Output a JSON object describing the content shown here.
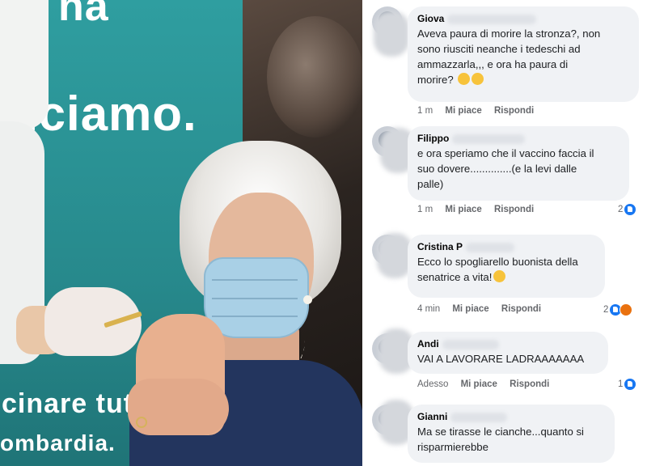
{
  "photo": {
    "poster_text_top": "na",
    "poster_text_middle": "nciamo.",
    "poster_text_bottom_1": "cinare tutta",
    "poster_text_bottom_2": "ombardia."
  },
  "comments": [
    {
      "author": "Giova",
      "text": "Aveva paura di morire la stronza?, non\nsono riusciti neanche i tedeschi ad\nammazzarla,,, e ora ha paura di\nmorire?",
      "emoji": "laughing-emoji x2",
      "time": "1 m",
      "like_label": "Mi piace",
      "reply_label": "Rispondi",
      "reaction_count": ""
    },
    {
      "author": "Filippo",
      "text": "e ora speriamo che il vaccino faccia il\nsuo dovere..............(e la levi dalle\npalle)",
      "time": "1 m",
      "like_label": "Mi piace",
      "reply_label": "Rispondi",
      "reaction_count": "2"
    },
    {
      "author": "Cristina P",
      "text": "Ecco lo spogliarello buonista della\nsenatrice a vita!",
      "emoji": "smirk-emoji",
      "time": "4 min",
      "like_label": "Mi piace",
      "reply_label": "Rispondi",
      "reaction_count": "2"
    },
    {
      "author": "Andi",
      "text": "VAI A LAVORARE LADRAAAAAAA",
      "time": "Adesso",
      "like_label": "Mi piace",
      "reply_label": "Rispondi",
      "reaction_count": "1"
    },
    {
      "author": "Gianni",
      "text": "Ma se tirasse le cianche...quanto si\nrisparmierebbe",
      "time": "",
      "like_label": "",
      "reply_label": "",
      "reaction_count": ""
    }
  ],
  "colors": {
    "bubble": "#f0f2f5",
    "meta_text": "#65676b",
    "like_blue": "#1877f2",
    "teal_poster": "#2f9ea0"
  }
}
